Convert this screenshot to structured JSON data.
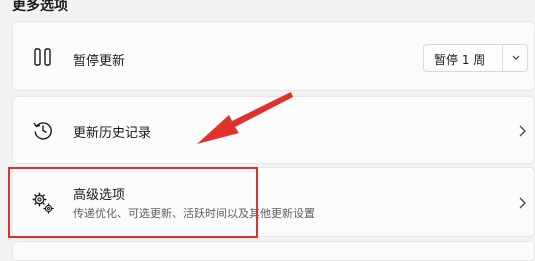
{
  "section": {
    "title": "更多选项"
  },
  "pause_card": {
    "label": "暂停更新",
    "icon": "pause-icon",
    "dropdown": {
      "value": "暂停 1 周",
      "icon": "chevron-down-icon"
    }
  },
  "history_card": {
    "label": "更新历史记录",
    "icon": "history-icon",
    "chevron": "chevron-right-icon"
  },
  "advanced_card": {
    "label": "高级选项",
    "description": "传递优化、可选更新、活跃时间以及其他更新设置",
    "icon": "gears-icon",
    "chevron": "chevron-right-icon"
  },
  "annotation": {
    "highlight_color": "#e0322c",
    "arrow_color": "#e0322c"
  }
}
